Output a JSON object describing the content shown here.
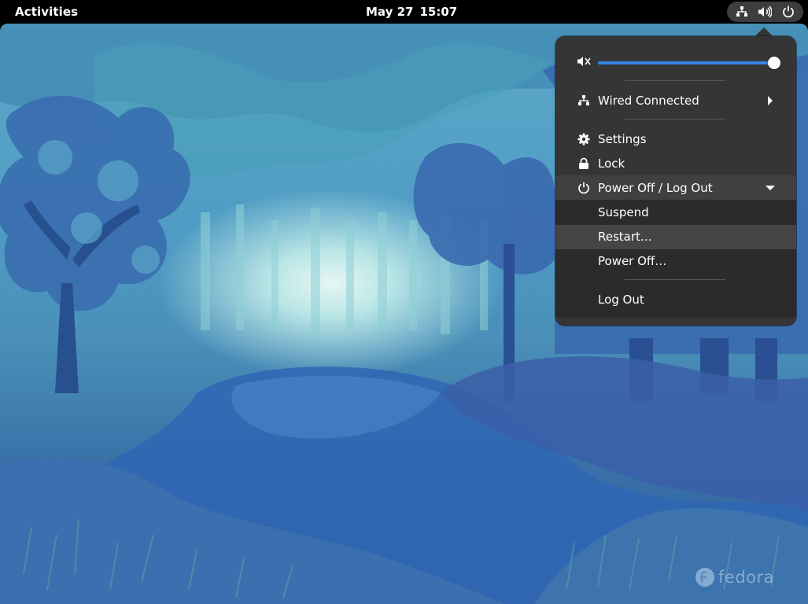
{
  "topbar": {
    "activities_label": "Activities",
    "date": "May 27",
    "time": "15:07"
  },
  "status_icons": [
    "network-wired-icon",
    "volume-icon",
    "power-icon"
  ],
  "system_menu": {
    "volume": {
      "level": 1.0,
      "icon": "volume-muted-icon"
    },
    "network": {
      "label": "Wired Connected",
      "icon": "network-wired-icon"
    },
    "items": [
      {
        "label": "Settings",
        "icon": "gear-icon"
      },
      {
        "label": "Lock",
        "icon": "lock-icon"
      },
      {
        "label": "Power Off / Log Out",
        "icon": "power-icon",
        "expanded": true
      }
    ],
    "power_submenu": [
      "Suspend",
      "Restart…",
      "Power Off…",
      "Log Out"
    ],
    "hovered_item": "Restart…"
  },
  "watermark": {
    "text": "fedora"
  },
  "colors": {
    "accent": "#3584e4",
    "menu_bg": "#353535",
    "submenu_bg": "#2b2b2b",
    "topbar_bg": "#000000"
  }
}
